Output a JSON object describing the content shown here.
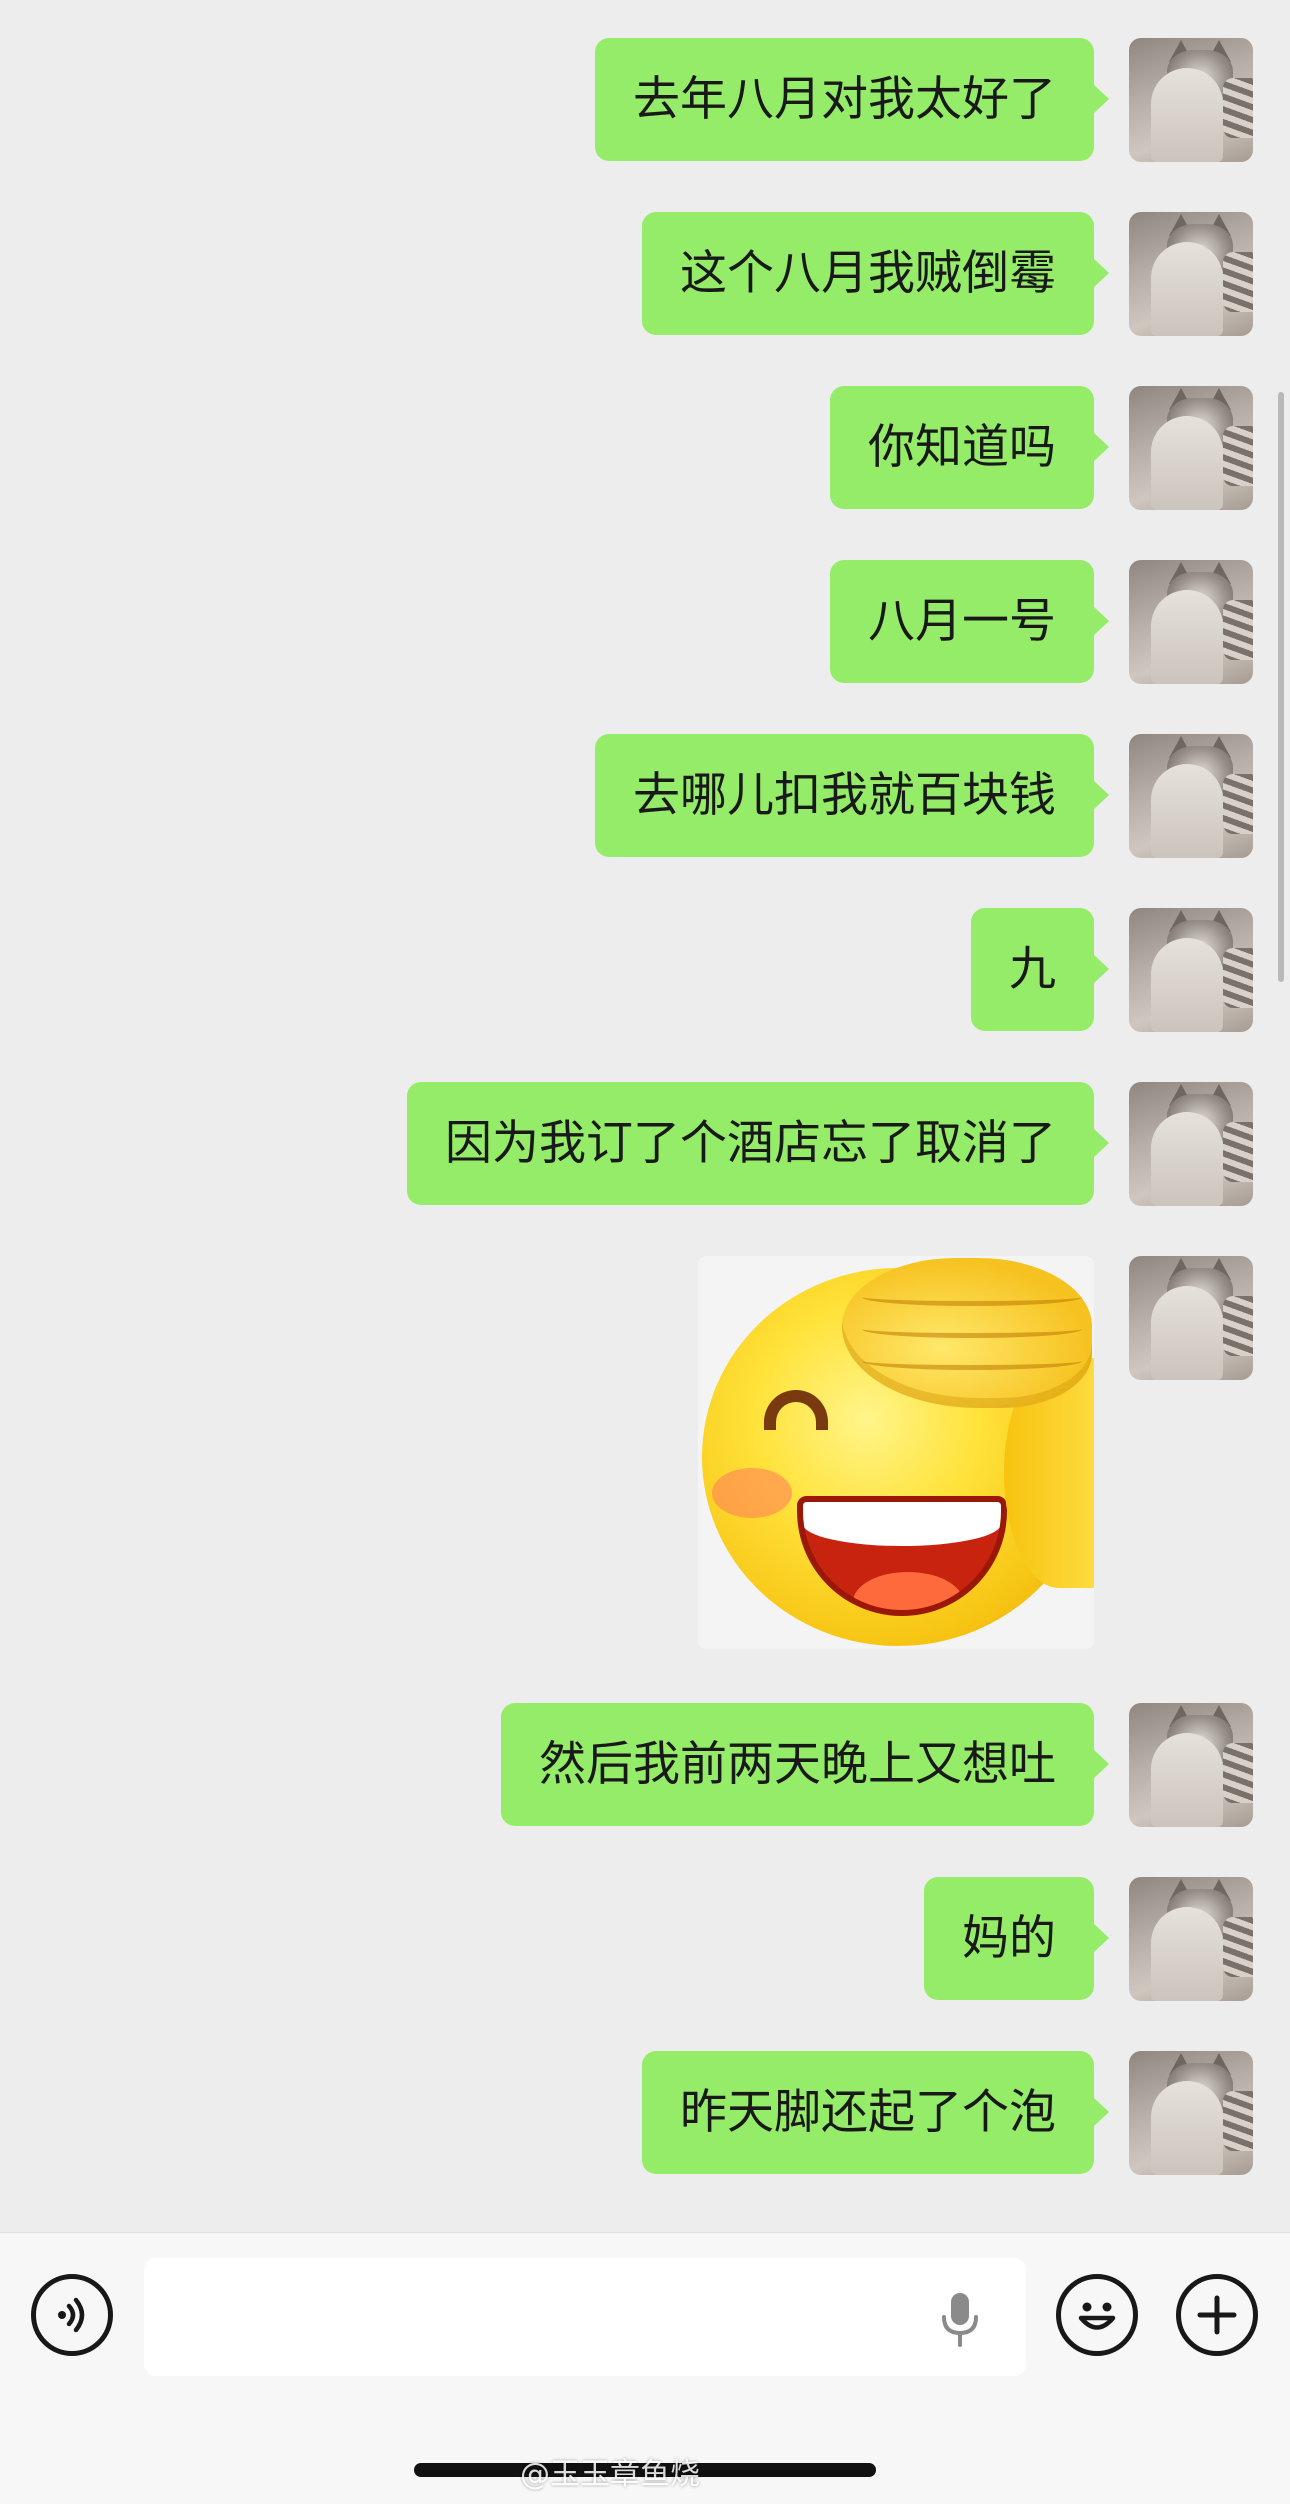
{
  "messages": [
    {
      "type": "text",
      "text": "去年八月对我太好了"
    },
    {
      "type": "text",
      "text": "这个八月我贼倒霉"
    },
    {
      "type": "text",
      "text": "你知道吗"
    },
    {
      "type": "text",
      "text": "八月一号"
    },
    {
      "type": "text",
      "text": "去哪儿扣我就百块钱"
    },
    {
      "type": "text",
      "text": "九"
    },
    {
      "type": "text",
      "text": "因为我订了个酒店忘了取消了"
    },
    {
      "type": "sticker",
      "sticker": "facepalm-laughing-emoji"
    },
    {
      "type": "text",
      "text": "然后我前两天晚上又想吐"
    },
    {
      "type": "text",
      "text": "妈的"
    },
    {
      "type": "text",
      "text": "昨天脚还起了个泡"
    }
  ],
  "colors": {
    "background": "#ededed",
    "sent_bubble": "#95ec69",
    "input_bar": "#f7f7f7"
  },
  "input_bar": {
    "value": "",
    "icons": [
      "voice-icon",
      "microphone-icon",
      "emoji-icon",
      "plus-icon"
    ]
  },
  "watermark": "@玉玉章鱼烧"
}
